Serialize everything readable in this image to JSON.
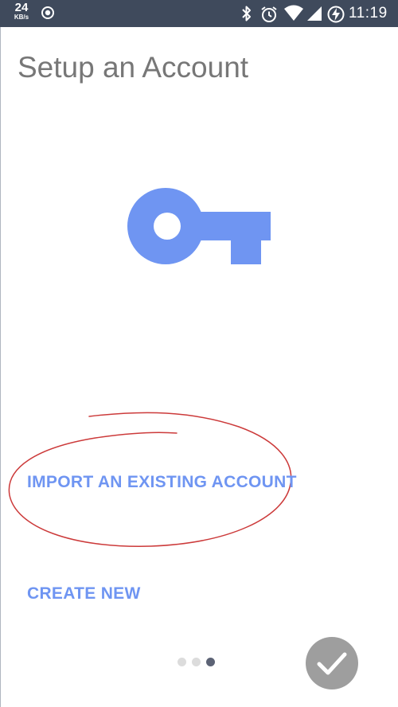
{
  "status_bar": {
    "net_speed_value": "24",
    "net_speed_unit": "KB/s",
    "time": "11:19",
    "icons": [
      "record-icon",
      "bluetooth-icon",
      "alarm-icon",
      "wifi-icon",
      "signal-icon",
      "battery-charging-icon"
    ]
  },
  "page": {
    "title": "Setup an Account",
    "hero_icon": "key-icon"
  },
  "actions": {
    "import_label": "IMPORT AN EXISTING ACCOUNT",
    "create_label": "CREATE NEW"
  },
  "pager": {
    "total": 3,
    "active_index": 2
  },
  "done_button": {
    "icon": "checkmark-icon"
  },
  "colors": {
    "status_bar": "#3f4a5c",
    "accent": "#6f95f2",
    "key": "#6f95f2",
    "title_text": "#777777",
    "annotation": "#cc3a3a",
    "done_button": "#9e9e9e"
  }
}
